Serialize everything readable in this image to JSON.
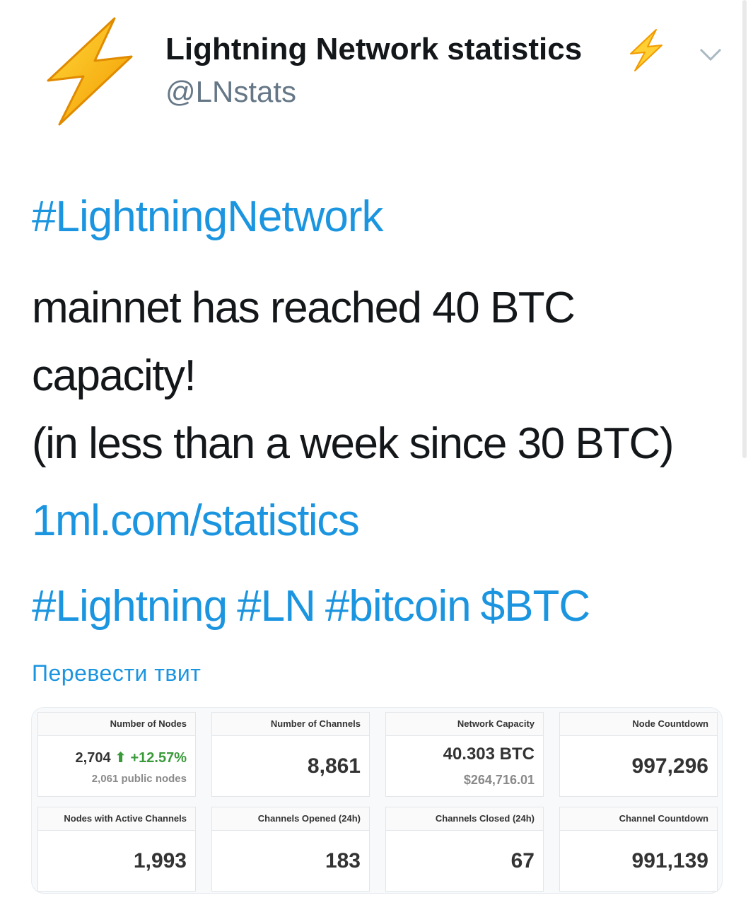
{
  "account": {
    "display_name": "Lightning Network statistics",
    "handle": "@LNstats"
  },
  "tweet": {
    "hashtag_main": "#LightningNetwork",
    "body_line1": "mainnet has reached 40 BTC capacity!",
    "body_line2": "(in less than a week since 30 BTC)",
    "link": "1ml.com/statistics",
    "tags": [
      "#Lightning",
      "#LN",
      "#bitcoin",
      "$BTC"
    ],
    "translate_label": "Перевести твит"
  },
  "stats": {
    "nodes": {
      "header": "Number of Nodes",
      "value": "2,704",
      "change": "+12.57%",
      "sub": "2,061 public nodes"
    },
    "channels": {
      "header": "Number of Channels",
      "value": "8,861"
    },
    "capacity": {
      "header": "Network Capacity",
      "value": "40.303 BTC",
      "usd": "$264,716.01"
    },
    "node_countdown": {
      "header": "Node Countdown",
      "value": "997,296"
    },
    "active_nodes": {
      "header": "Nodes with Active Channels",
      "value": "1,993"
    },
    "opened": {
      "header": "Channels Opened (24h)",
      "value": "183"
    },
    "closed": {
      "header": "Channels Closed (24h)",
      "value": "67"
    },
    "channel_countdown": {
      "header": "Channel Countdown",
      "value": "991,139"
    }
  },
  "icons": {
    "avatar": "lightning-bolt-emoji",
    "name_badge": "lightning-bolt-emoji",
    "menu": "chevron-down-icon",
    "trend": "arrow-up-icon"
  },
  "colors": {
    "link": "#1b95e0",
    "text": "#14171a",
    "secondary": "#657786",
    "bolt": "#f7b500",
    "trend_up": "#3a9a3a"
  }
}
